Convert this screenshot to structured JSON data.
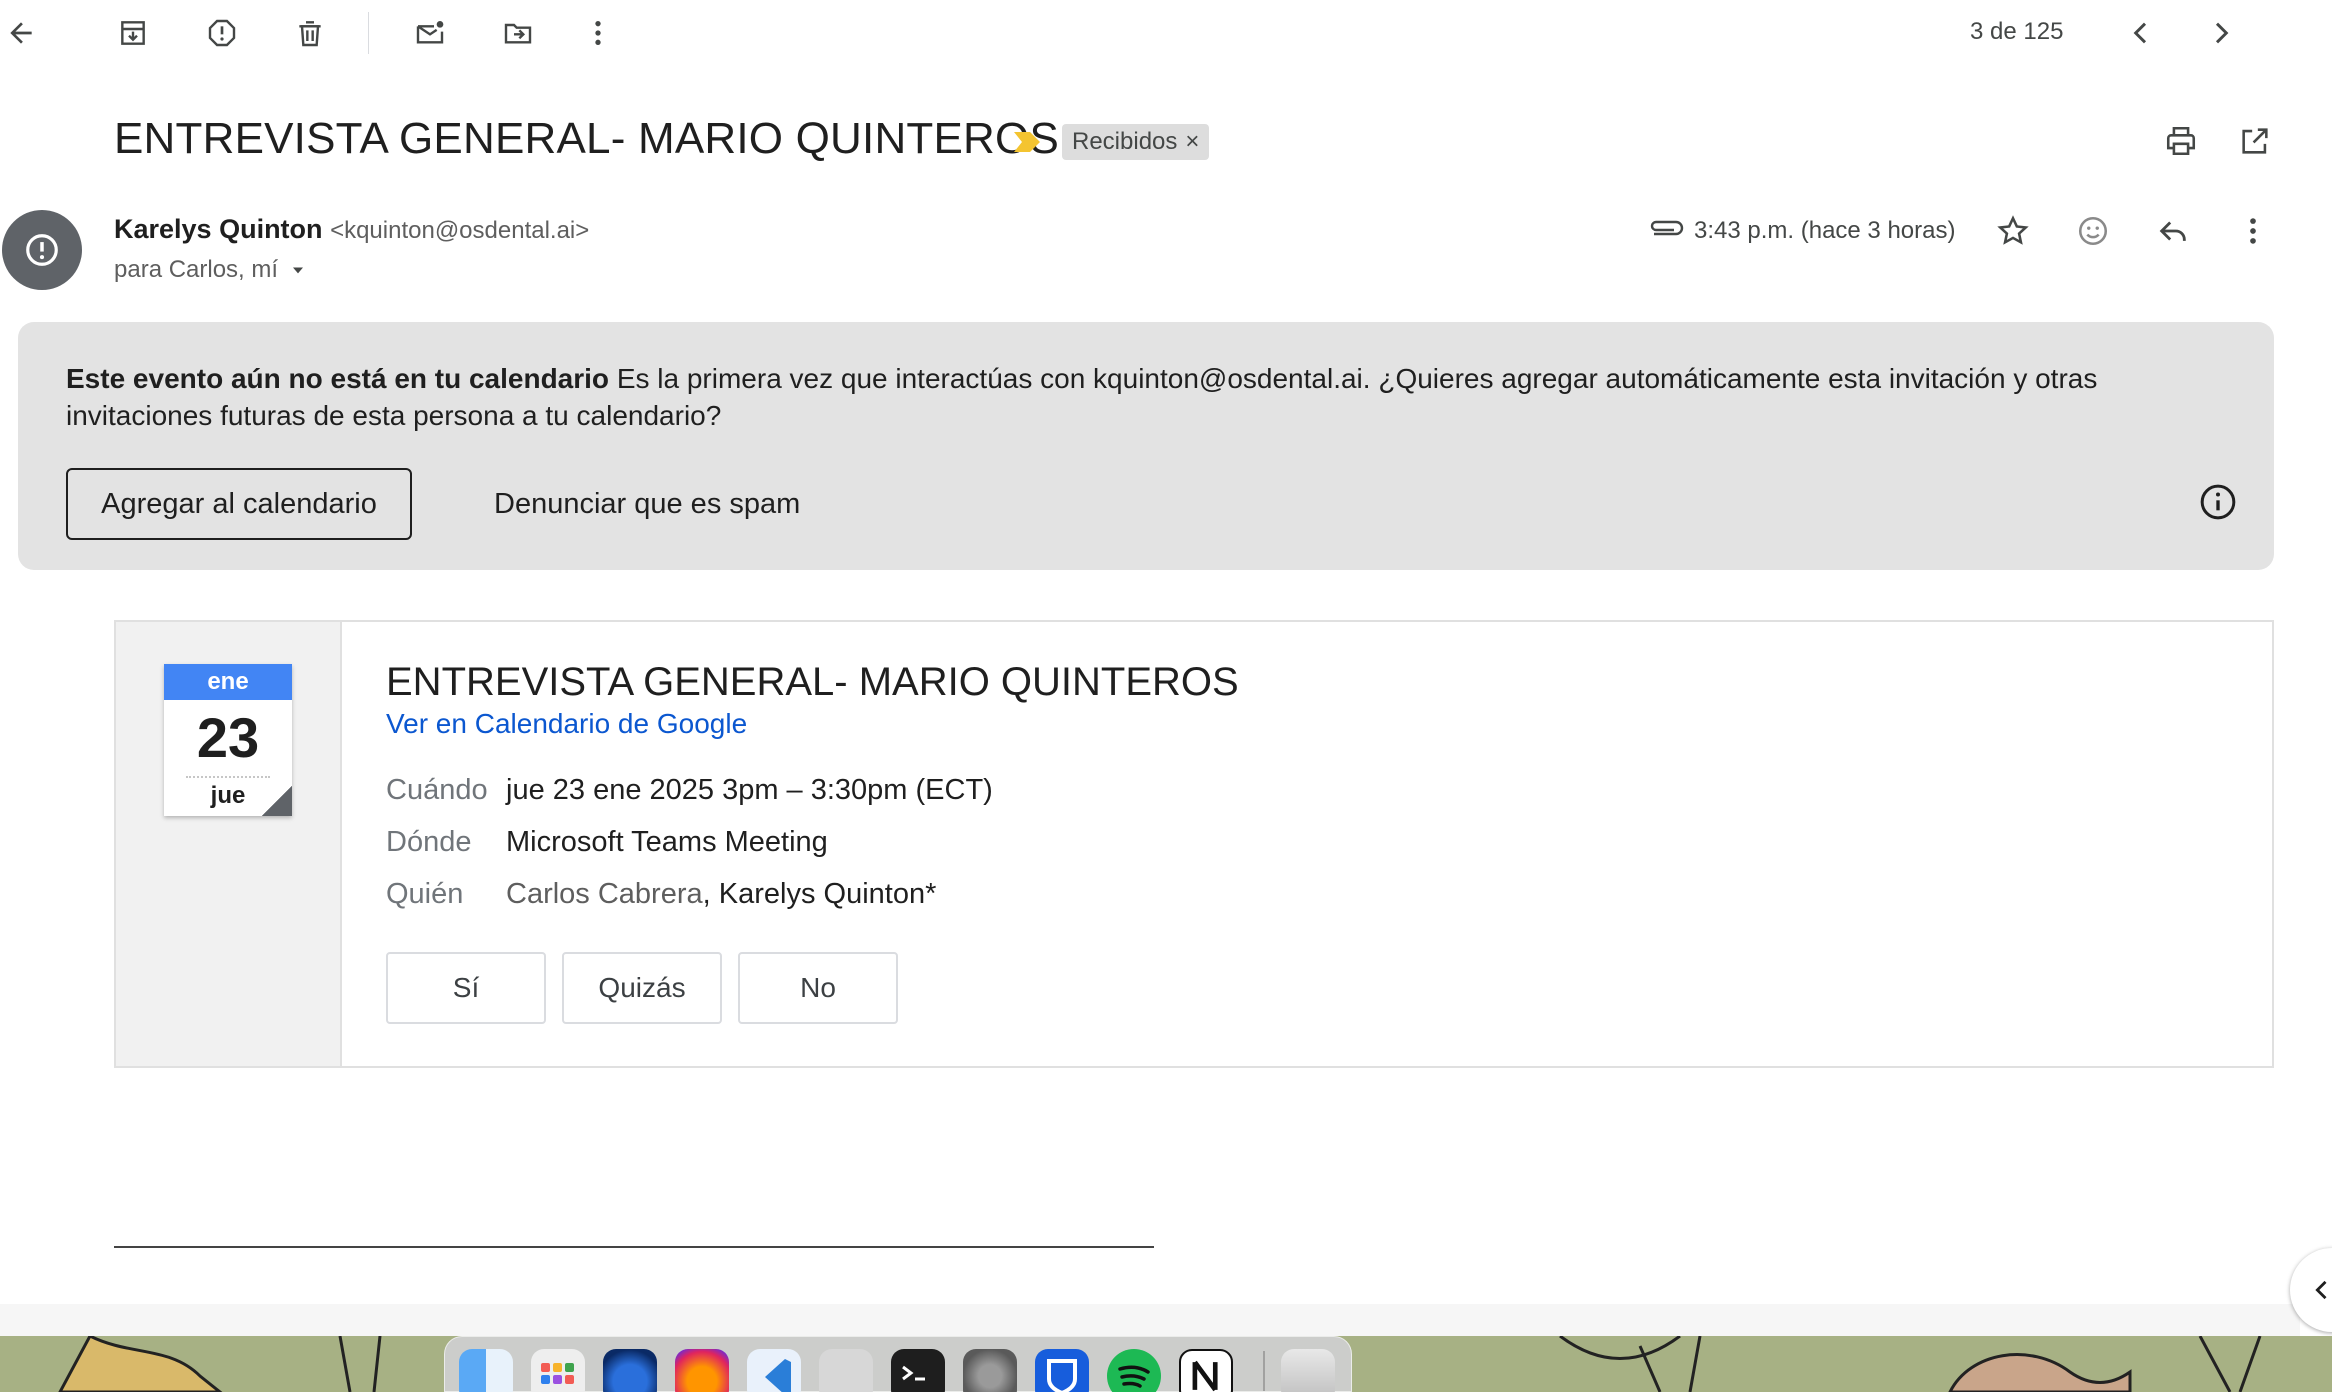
{
  "toolbar": {
    "pager_text": "3 de 125",
    "icons": [
      "back-arrow-icon",
      "archive-icon",
      "report-spam-icon",
      "delete-icon",
      "mark-unread-icon",
      "move-to-icon",
      "more-vert-icon",
      "chevron-left-icon",
      "chevron-right-icon"
    ]
  },
  "email": {
    "subject": "ENTREVISTA GENERAL- MARIO QUINTEROS",
    "label": "Recibidos",
    "label_remove": "×",
    "sender_name": "Karelys Quinton",
    "sender_email": "<kquinton@osdental.ai>",
    "recipients": "para Carlos, mí",
    "timestamp": "3:43 p.m. (hace 3 horas)",
    "importance_color": "#f4c430"
  },
  "banner": {
    "title": "Este evento aún no está en tu calendario",
    "body": " Es la primera vez que interactúas con kquinton@osdental.ai. ¿Quieres agregar automáticamente esta invitación y otras invitaciones futuras de esta persona a tu calendario?",
    "add_button": "Agregar al calendario",
    "spam_button": "Denunciar que es spam"
  },
  "invite": {
    "calendar": {
      "month": "ene",
      "day": "23",
      "weekday": "jue"
    },
    "title": "ENTREVISTA GENERAL- MARIO QUINTEROS",
    "link": "Ver en Calendario de Google",
    "when_label": "Cuándo",
    "when_value": "jue 23 ene 2025 3pm – 3:30pm (ECT)",
    "where_label": "Dónde",
    "where_value": "Microsoft Teams Meeting",
    "who_label": "Quién",
    "who_guest": "Carlos Cabrera",
    "who_sep": ", ",
    "who_organizer": "Karelys Quinton*",
    "rsvp": {
      "yes": "Sí",
      "maybe": "Quizás",
      "no": "No"
    }
  },
  "colors": {
    "accent_blue": "#0b57d0",
    "calendar_blue": "#4285f4",
    "banner_bg": "#e3e3e3",
    "avatar_bg": "#5f6368"
  },
  "dock": {
    "apps": [
      "finder-icon",
      "launchpad-icon",
      "firefox-dev-icon",
      "firefox-icon",
      "vscode-icon",
      "preview-icon",
      "terminal-icon",
      "system-settings-icon",
      "bitwarden-icon",
      "spotify-icon",
      "notion-icon",
      "trash-icon"
    ]
  }
}
